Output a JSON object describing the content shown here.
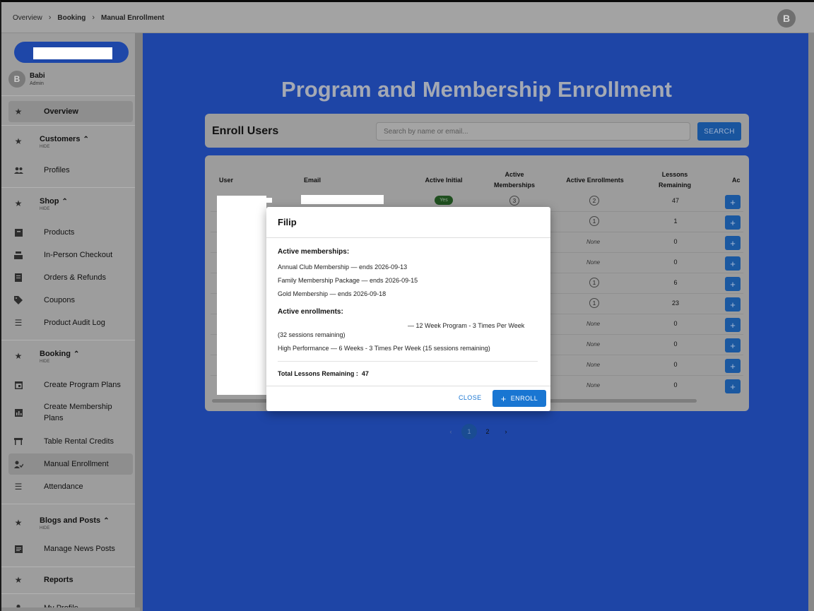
{
  "breadcrumb": {
    "items": [
      "Overview",
      "Booking",
      "Manual Enrollment"
    ]
  },
  "top_avatar": {
    "initial": "B"
  },
  "sidebar": {
    "user": {
      "initial": "B",
      "name": "Babi",
      "role": "Admin"
    },
    "overview": {
      "label": "Overview",
      "icon": "star-icon"
    },
    "customers": {
      "label": "Customers",
      "hide": "HIDE",
      "icon": "star-icon",
      "items": [
        {
          "label": "Profiles",
          "icon": "people-icon"
        }
      ]
    },
    "shop": {
      "label": "Shop",
      "hide": "HIDE",
      "icon": "star-icon",
      "items": [
        {
          "label": "Products",
          "icon": "inventory-icon"
        },
        {
          "label": "In-Person Checkout",
          "icon": "register-icon"
        },
        {
          "label": "Orders & Refunds",
          "icon": "receipt-icon"
        },
        {
          "label": "Coupons",
          "icon": "tag-icon"
        },
        {
          "label": "Product Audit Log",
          "icon": "checklist-icon"
        }
      ]
    },
    "booking": {
      "label": "Booking",
      "hide": "HIDE",
      "icon": "star-icon",
      "items": [
        {
          "label": "Create Program Plans",
          "icon": "calendar-icon"
        },
        {
          "label": "Create Membership Plans",
          "icon": "bar-chart-icon"
        },
        {
          "label": "Table Rental Credits",
          "icon": "table-icon"
        },
        {
          "label": "Manual Enrollment",
          "icon": "person-check-icon"
        },
        {
          "label": "Attendance",
          "icon": "checklist-icon"
        }
      ]
    },
    "blogs": {
      "label": "Blogs and Posts",
      "hide": "HIDE",
      "icon": "star-icon",
      "items": [
        {
          "label": "Manage News Posts",
          "icon": "article-icon"
        }
      ]
    },
    "reports": {
      "label": "Reports",
      "icon": "star-icon"
    },
    "cut_item": {
      "label": "My Profile"
    }
  },
  "main": {
    "title": "Program and Membership Enrollment",
    "enroll_bar": {
      "title": "Enroll Users",
      "search_placeholder": "Search by name or email...",
      "search_button": "SEARCH"
    },
    "table": {
      "headers": [
        "User",
        "Email",
        "Active Initial",
        "Active Memberships",
        "Active Enrollments",
        "Lessons Remaining",
        "Ac"
      ],
      "rows": [
        {
          "active_initial": "Yes",
          "memberships": "3",
          "enrollments": "2",
          "lessons": "47"
        },
        {
          "memberships": "",
          "enrollments": "1",
          "lessons": "1"
        },
        {
          "memberships": "",
          "enrollments": "None",
          "lessons": "0"
        },
        {
          "memberships": "",
          "enrollments": "None",
          "lessons": "0"
        },
        {
          "memberships": "",
          "enrollments": "1",
          "lessons": "6"
        },
        {
          "memberships": "",
          "enrollments": "1",
          "lessons": "23"
        },
        {
          "memberships": "",
          "enrollments": "None",
          "lessons": "0"
        },
        {
          "memberships": "",
          "enrollments": "None",
          "lessons": "0"
        },
        {
          "memberships": "",
          "enrollments": "None",
          "lessons": "0"
        },
        {
          "memberships": "",
          "enrollments": "None",
          "lessons": "0"
        }
      ],
      "action_label": "+"
    },
    "pagination": {
      "prev": "‹",
      "pages": [
        "1",
        "2"
      ],
      "current": "1",
      "next": "›"
    }
  },
  "modal": {
    "title": "Filip",
    "memberships_heading": "Active memberships:",
    "memberships": [
      "Annual Club Membership — ends 2026-09-13",
      "Family Membership Package — ends 2026-09-15",
      "Gold Membership — ends 2026-09-18"
    ],
    "enrollments_heading": "Active enrollments:",
    "enrollment_1_line1": "— 12 Week Program - 3 Times Per Week",
    "enrollment_1_line2": "(32 sessions remaining)",
    "enrollment_2": "High Performance — 6 Weeks - 3 Times Per Week (15 sessions remaining)",
    "total_label": "Total Lessons Remaining :",
    "total_value": "47",
    "close_label": "CLOSE",
    "enroll_label": "ENROLL"
  },
  "colors": {
    "accent": "#1976d2",
    "overlay_blue": "#1e45a6",
    "success": "#1f4f1f"
  }
}
